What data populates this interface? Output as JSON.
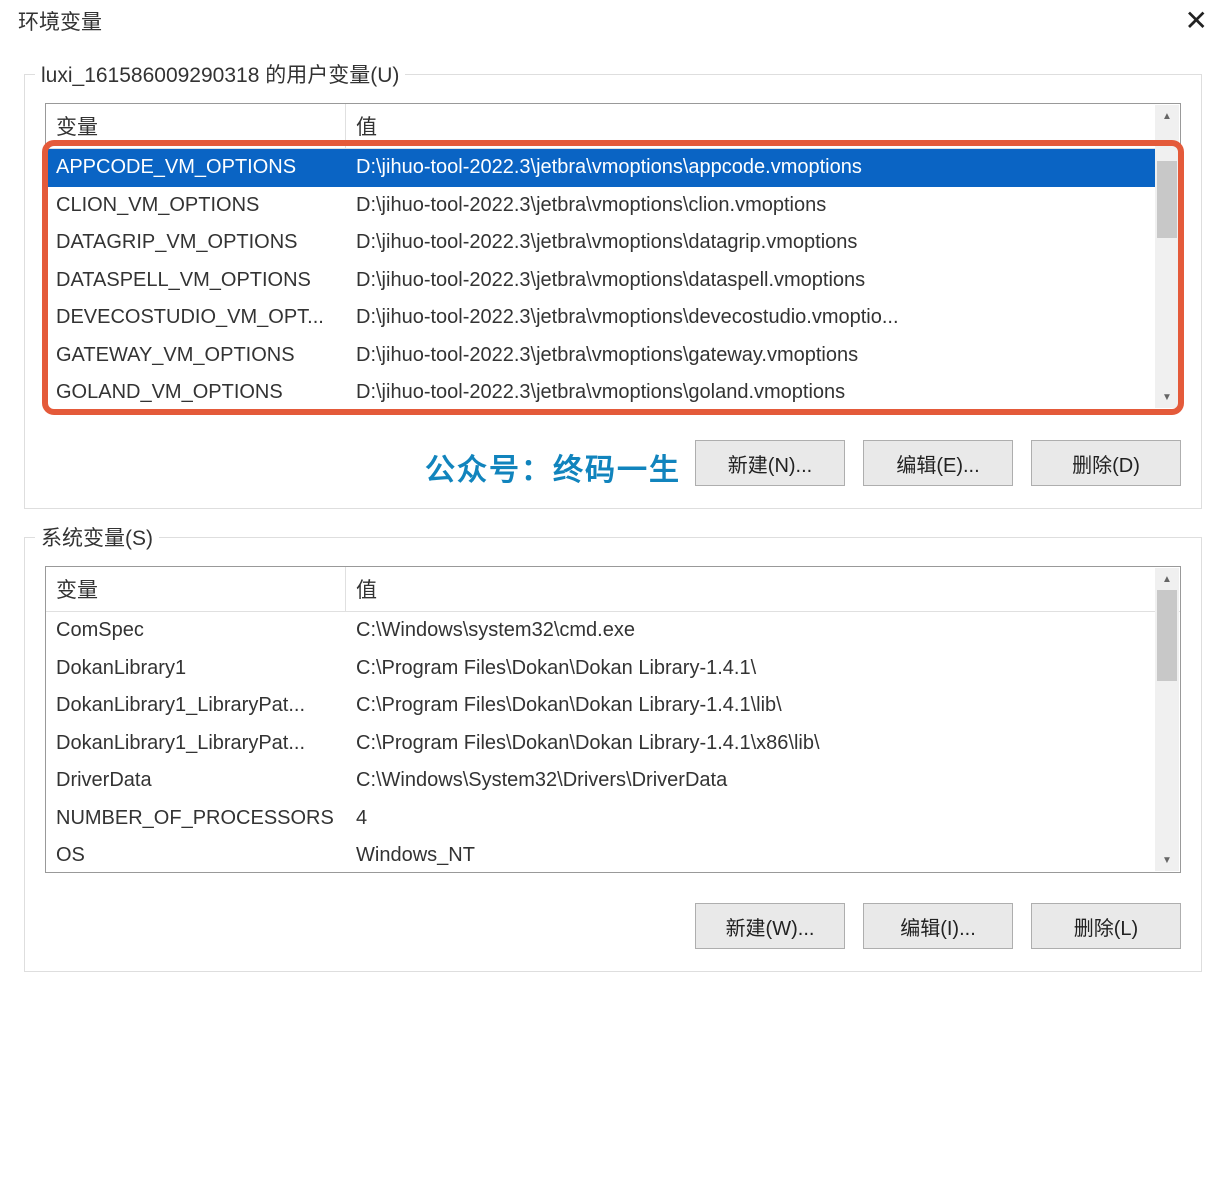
{
  "title": "环境变量",
  "watermark": "公众号：终码一生",
  "user_group": {
    "legend": "luxi_161586009290318 的用户变量(U)",
    "header_var": "变量",
    "header_val": "值",
    "rows": [
      {
        "var": "APPCODE_VM_OPTIONS",
        "val": "D:\\jihuo-tool-2022.3\\jetbra\\vmoptions\\appcode.vmoptions",
        "selected": true
      },
      {
        "var": "CLION_VM_OPTIONS",
        "val": "D:\\jihuo-tool-2022.3\\jetbra\\vmoptions\\clion.vmoptions"
      },
      {
        "var": "DATAGRIP_VM_OPTIONS",
        "val": "D:\\jihuo-tool-2022.3\\jetbra\\vmoptions\\datagrip.vmoptions"
      },
      {
        "var": "DATASPELL_VM_OPTIONS",
        "val": "D:\\jihuo-tool-2022.3\\jetbra\\vmoptions\\dataspell.vmoptions"
      },
      {
        "var": "DEVECOSTUDIO_VM_OPT...",
        "val": "D:\\jihuo-tool-2022.3\\jetbra\\vmoptions\\devecostudio.vmoptio..."
      },
      {
        "var": "GATEWAY_VM_OPTIONS",
        "val": "D:\\jihuo-tool-2022.3\\jetbra\\vmoptions\\gateway.vmoptions"
      },
      {
        "var": "GOLAND_VM_OPTIONS",
        "val": "D:\\jihuo-tool-2022.3\\jetbra\\vmoptions\\goland.vmoptions"
      }
    ],
    "buttons": {
      "new": "新建(N)...",
      "edit": "编辑(E)...",
      "delete": "删除(D)"
    }
  },
  "system_group": {
    "legend": "系统变量(S)",
    "header_var": "变量",
    "header_val": "值",
    "rows": [
      {
        "var": "ComSpec",
        "val": "C:\\Windows\\system32\\cmd.exe"
      },
      {
        "var": "DokanLibrary1",
        "val": "C:\\Program Files\\Dokan\\Dokan Library-1.4.1\\"
      },
      {
        "var": "DokanLibrary1_LibraryPat...",
        "val": "C:\\Program Files\\Dokan\\Dokan Library-1.4.1\\lib\\"
      },
      {
        "var": "DokanLibrary1_LibraryPat...",
        "val": "C:\\Program Files\\Dokan\\Dokan Library-1.4.1\\x86\\lib\\"
      },
      {
        "var": "DriverData",
        "val": "C:\\Windows\\System32\\Drivers\\DriverData"
      },
      {
        "var": "NUMBER_OF_PROCESSORS",
        "val": "4"
      },
      {
        "var": "OS",
        "val": "Windows_NT"
      }
    ],
    "buttons": {
      "new": "新建(W)...",
      "edit": "编辑(I)...",
      "delete": "删除(L)"
    }
  }
}
